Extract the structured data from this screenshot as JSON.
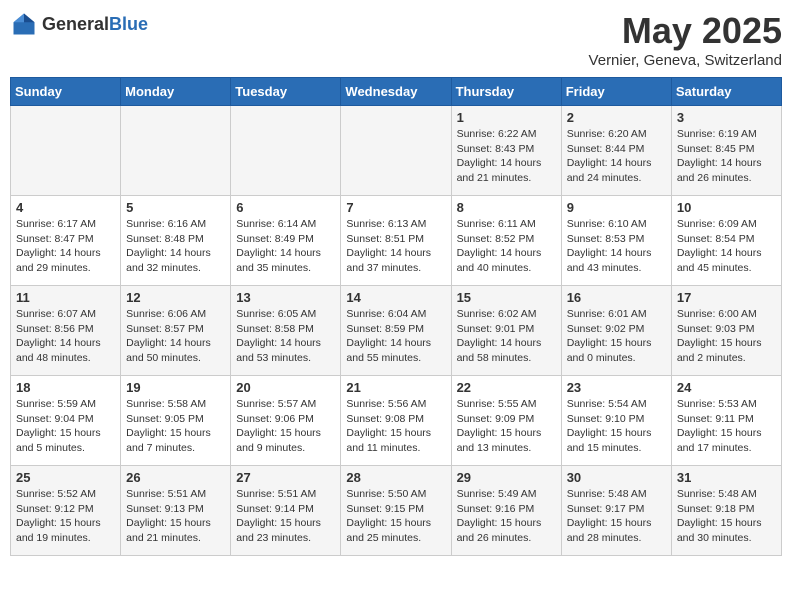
{
  "header": {
    "logo_general": "General",
    "logo_blue": "Blue",
    "month": "May 2025",
    "location": "Vernier, Geneva, Switzerland"
  },
  "days_of_week": [
    "Sunday",
    "Monday",
    "Tuesday",
    "Wednesday",
    "Thursday",
    "Friday",
    "Saturday"
  ],
  "weeks": [
    [
      {
        "day": "",
        "info": ""
      },
      {
        "day": "",
        "info": ""
      },
      {
        "day": "",
        "info": ""
      },
      {
        "day": "",
        "info": ""
      },
      {
        "day": "1",
        "info": "Sunrise: 6:22 AM\nSunset: 8:43 PM\nDaylight: 14 hours\nand 21 minutes."
      },
      {
        "day": "2",
        "info": "Sunrise: 6:20 AM\nSunset: 8:44 PM\nDaylight: 14 hours\nand 24 minutes."
      },
      {
        "day": "3",
        "info": "Sunrise: 6:19 AM\nSunset: 8:45 PM\nDaylight: 14 hours\nand 26 minutes."
      }
    ],
    [
      {
        "day": "4",
        "info": "Sunrise: 6:17 AM\nSunset: 8:47 PM\nDaylight: 14 hours\nand 29 minutes."
      },
      {
        "day": "5",
        "info": "Sunrise: 6:16 AM\nSunset: 8:48 PM\nDaylight: 14 hours\nand 32 minutes."
      },
      {
        "day": "6",
        "info": "Sunrise: 6:14 AM\nSunset: 8:49 PM\nDaylight: 14 hours\nand 35 minutes."
      },
      {
        "day": "7",
        "info": "Sunrise: 6:13 AM\nSunset: 8:51 PM\nDaylight: 14 hours\nand 37 minutes."
      },
      {
        "day": "8",
        "info": "Sunrise: 6:11 AM\nSunset: 8:52 PM\nDaylight: 14 hours\nand 40 minutes."
      },
      {
        "day": "9",
        "info": "Sunrise: 6:10 AM\nSunset: 8:53 PM\nDaylight: 14 hours\nand 43 minutes."
      },
      {
        "day": "10",
        "info": "Sunrise: 6:09 AM\nSunset: 8:54 PM\nDaylight: 14 hours\nand 45 minutes."
      }
    ],
    [
      {
        "day": "11",
        "info": "Sunrise: 6:07 AM\nSunset: 8:56 PM\nDaylight: 14 hours\nand 48 minutes."
      },
      {
        "day": "12",
        "info": "Sunrise: 6:06 AM\nSunset: 8:57 PM\nDaylight: 14 hours\nand 50 minutes."
      },
      {
        "day": "13",
        "info": "Sunrise: 6:05 AM\nSunset: 8:58 PM\nDaylight: 14 hours\nand 53 minutes."
      },
      {
        "day": "14",
        "info": "Sunrise: 6:04 AM\nSunset: 8:59 PM\nDaylight: 14 hours\nand 55 minutes."
      },
      {
        "day": "15",
        "info": "Sunrise: 6:02 AM\nSunset: 9:01 PM\nDaylight: 14 hours\nand 58 minutes."
      },
      {
        "day": "16",
        "info": "Sunrise: 6:01 AM\nSunset: 9:02 PM\nDaylight: 15 hours\nand 0 minutes."
      },
      {
        "day": "17",
        "info": "Sunrise: 6:00 AM\nSunset: 9:03 PM\nDaylight: 15 hours\nand 2 minutes."
      }
    ],
    [
      {
        "day": "18",
        "info": "Sunrise: 5:59 AM\nSunset: 9:04 PM\nDaylight: 15 hours\nand 5 minutes."
      },
      {
        "day": "19",
        "info": "Sunrise: 5:58 AM\nSunset: 9:05 PM\nDaylight: 15 hours\nand 7 minutes."
      },
      {
        "day": "20",
        "info": "Sunrise: 5:57 AM\nSunset: 9:06 PM\nDaylight: 15 hours\nand 9 minutes."
      },
      {
        "day": "21",
        "info": "Sunrise: 5:56 AM\nSunset: 9:08 PM\nDaylight: 15 hours\nand 11 minutes."
      },
      {
        "day": "22",
        "info": "Sunrise: 5:55 AM\nSunset: 9:09 PM\nDaylight: 15 hours\nand 13 minutes."
      },
      {
        "day": "23",
        "info": "Sunrise: 5:54 AM\nSunset: 9:10 PM\nDaylight: 15 hours\nand 15 minutes."
      },
      {
        "day": "24",
        "info": "Sunrise: 5:53 AM\nSunset: 9:11 PM\nDaylight: 15 hours\nand 17 minutes."
      }
    ],
    [
      {
        "day": "25",
        "info": "Sunrise: 5:52 AM\nSunset: 9:12 PM\nDaylight: 15 hours\nand 19 minutes."
      },
      {
        "day": "26",
        "info": "Sunrise: 5:51 AM\nSunset: 9:13 PM\nDaylight: 15 hours\nand 21 minutes."
      },
      {
        "day": "27",
        "info": "Sunrise: 5:51 AM\nSunset: 9:14 PM\nDaylight: 15 hours\nand 23 minutes."
      },
      {
        "day": "28",
        "info": "Sunrise: 5:50 AM\nSunset: 9:15 PM\nDaylight: 15 hours\nand 25 minutes."
      },
      {
        "day": "29",
        "info": "Sunrise: 5:49 AM\nSunset: 9:16 PM\nDaylight: 15 hours\nand 26 minutes."
      },
      {
        "day": "30",
        "info": "Sunrise: 5:48 AM\nSunset: 9:17 PM\nDaylight: 15 hours\nand 28 minutes."
      },
      {
        "day": "31",
        "info": "Sunrise: 5:48 AM\nSunset: 9:18 PM\nDaylight: 15 hours\nand 30 minutes."
      }
    ]
  ]
}
